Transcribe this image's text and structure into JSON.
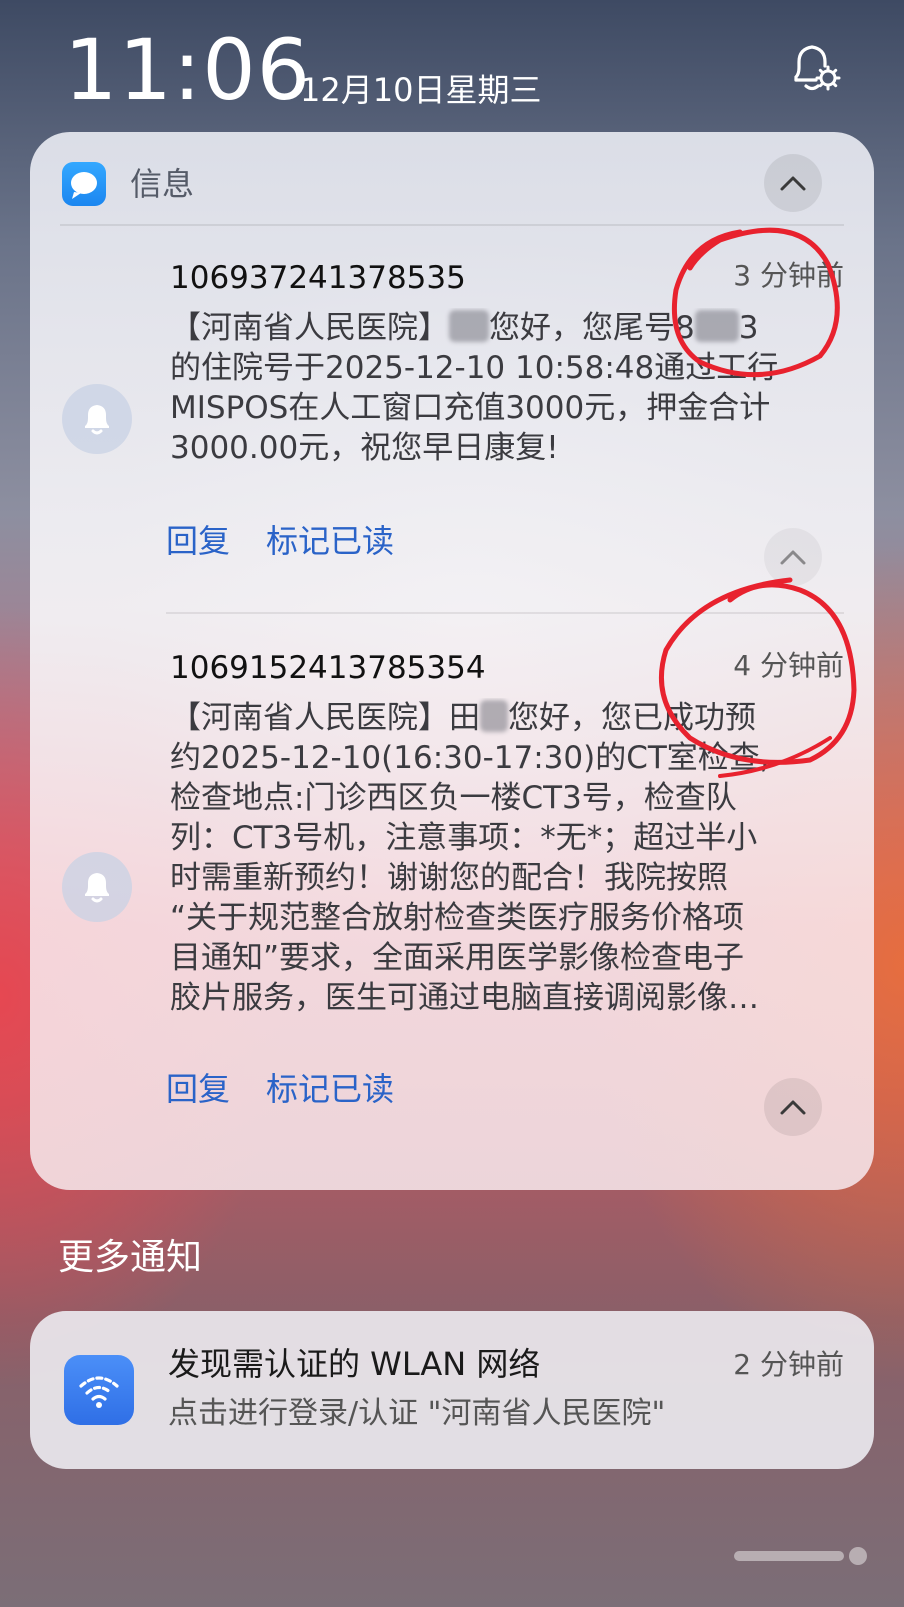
{
  "status_bar": {
    "time": "11:06",
    "date": "12月10日星期三",
    "settings_icon": "bell-gear-icon"
  },
  "messages_group": {
    "app_name": "信息",
    "app_icon": "chat-bubble-icon",
    "accent_color": "#2a63c8",
    "notifications": [
      {
        "sender": "106937241378535",
        "time": "3 分钟前",
        "lines": [
          [
            "【河南省人民医院】",
            "",
            "您好，您尾号8",
            "",
            "3"
          ],
          [
            "的住院号于2025-12-10 10:58:48通过工行"
          ],
          [
            "MISPOS在人工窗口充值3000元，押金合计"
          ],
          [
            "3000.00元，祝您早日康复!"
          ]
        ],
        "reply": "回复",
        "mark_read": "标记已读"
      },
      {
        "sender": "1069152413785354",
        "time": "4 分钟前",
        "lines": [
          [
            "【河南省人民医院】田",
            "",
            "您好，您已成功预"
          ],
          [
            "约2025-12-10(16:30-17:30)的CT室检查,"
          ],
          [
            "检查地点:门诊西区负一楼CT3号，检查队"
          ],
          [
            "列：CT3号机，注意事项：*无*；超过半小"
          ],
          [
            "时需重新预约！谢谢您的配合！我院按照"
          ],
          [
            "“关于规范整合放射检查类医疗服务价格项"
          ],
          [
            "目通知”要求，全面采用医学影像检查电子"
          ],
          [
            "胶片服务，医生可通过电脑直接调阅影像…"
          ]
        ],
        "reply": "回复",
        "mark_read": "标记已读"
      }
    ]
  },
  "more_notifications": {
    "title": "更多通知",
    "wlan": {
      "icon": "wifi-icon",
      "title": "发现需认证的 WLAN 网络",
      "time": "2 分钟前",
      "subtitle": "点击进行登录/认证 \"河南省人民医院\""
    }
  }
}
